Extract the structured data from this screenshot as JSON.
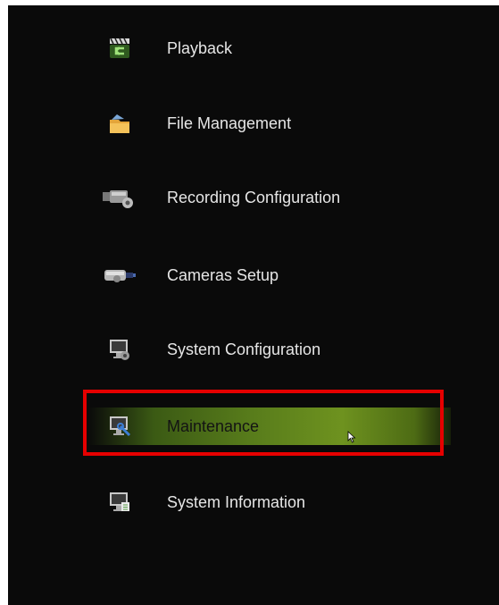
{
  "menu": {
    "items": [
      {
        "label": "Playback",
        "icon": "playback-clapper-icon"
      },
      {
        "label": "File Management",
        "icon": "folder-icon"
      },
      {
        "label": "Recording Configuration",
        "icon": "video-camera-gear-icon"
      },
      {
        "label": "Cameras Setup",
        "icon": "security-camera-icon"
      },
      {
        "label": "System Configuration",
        "icon": "monitor-gear-icon"
      },
      {
        "label": "Maintenance",
        "icon": "monitor-wrench-icon"
      },
      {
        "label": "System Information",
        "icon": "monitor-info-icon"
      }
    ],
    "selected_index": 5
  },
  "colors": {
    "background": "#0a0a0a",
    "text": "#e6e6e6",
    "highlight": "#6e921f",
    "annotation_box": "#e60000"
  }
}
